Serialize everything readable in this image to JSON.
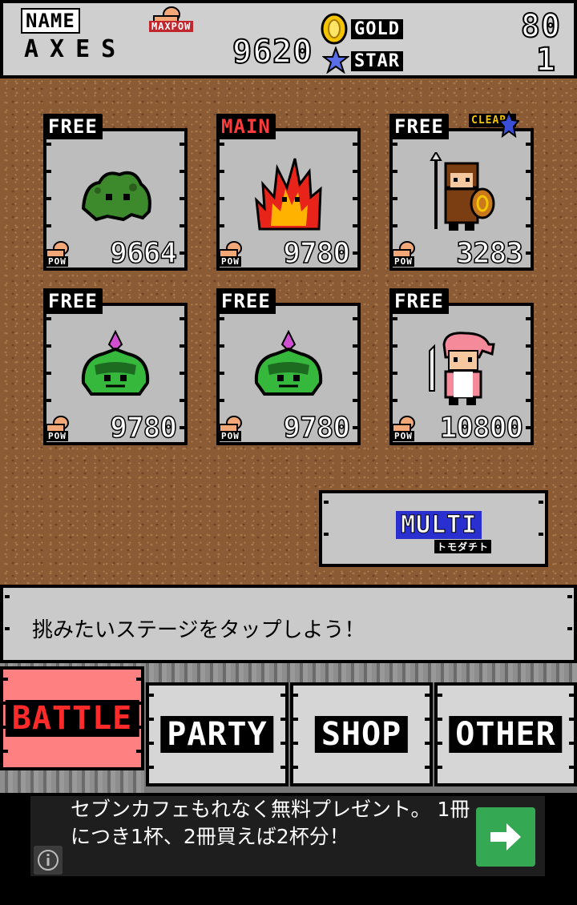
{
  "header": {
    "name_label": "NAME",
    "player_name": "AXES",
    "maxpow_label": "MAXPOW",
    "maxpow_value": "9620",
    "gold_label": "GOLD",
    "gold_value": "80",
    "star_label": "STAR",
    "star_value": "1"
  },
  "stages": [
    {
      "tag": "FREE",
      "pow_label": "POW",
      "pow": "9664",
      "sprite": "green-slime-monster",
      "clear": ""
    },
    {
      "tag": "MAIN",
      "pow_label": "POW",
      "pow": "9780",
      "sprite": "fire-elemental",
      "clear": ""
    },
    {
      "tag": "FREE",
      "pow_label": "POW",
      "pow": "3283",
      "sprite": "shield-warrior",
      "clear": "CLEAR!"
    },
    {
      "tag": "FREE",
      "pow_label": "POW",
      "pow": "9780",
      "sprite": "flower-plant-monster",
      "clear": ""
    },
    {
      "tag": "FREE",
      "pow_label": "POW",
      "pow": "9780",
      "sprite": "flower-plant-monster",
      "clear": ""
    },
    {
      "tag": "FREE",
      "pow_label": "POW",
      "pow": "10800",
      "sprite": "pink-hair-swordsman",
      "clear": ""
    }
  ],
  "multi": {
    "label": "MULTI",
    "sub_label": "トモダチト"
  },
  "message": "挑みたいステージをタップしよう！",
  "tabs": [
    {
      "label": "BATTLE",
      "active": true
    },
    {
      "label": "PARTY",
      "active": false
    },
    {
      "label": "SHOP",
      "active": false
    },
    {
      "label": "OTHER",
      "active": false
    }
  ],
  "ad": {
    "text": "セブンカフェもれなく無料プレゼント。 1冊につき1杯、2冊買えば2杯分！",
    "info_icon": "info-icon",
    "arrow_icon": "arrow-right-icon"
  },
  "colors": {
    "ground": "#8b5b35",
    "panel": "#c9c9c9",
    "battle_tab": "#ff8080",
    "main_tag": "#ff3b3b",
    "multi_label_bg": "#2a2fd0",
    "ad_button": "#35a853"
  }
}
